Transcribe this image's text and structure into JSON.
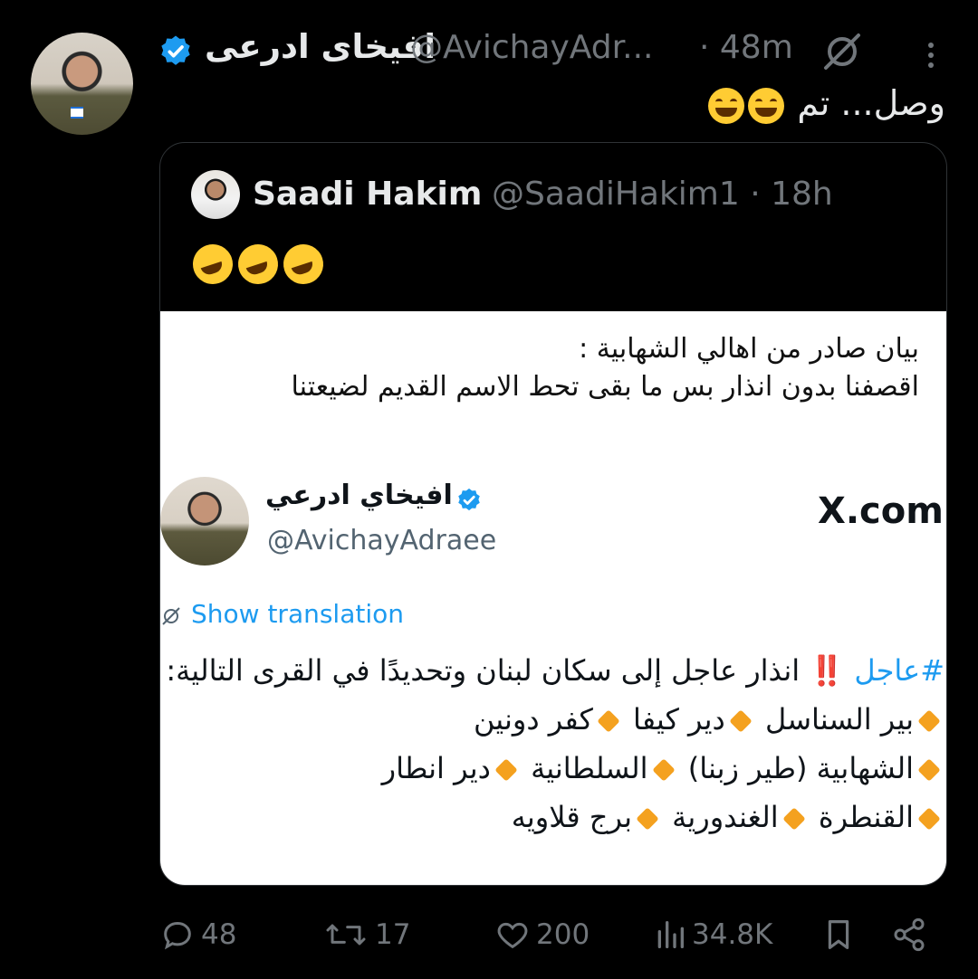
{
  "tweet": {
    "author_name": "افيخاى ادرعى",
    "author_handle": "@AvichayAdr...",
    "time": "· 48m",
    "text": "وصل... تم"
  },
  "quote": {
    "author_name": "Saadi Hakim",
    "author_handle": "@SaadiHakim1 · 18h"
  },
  "embed": {
    "line1": "بيان صادر من اهالي الشهابية :",
    "line2": "اقصفنا بدون انذار بس ما بقى تحط الاسم القديم لضيعتنا",
    "name": "افيخاي ادرعي",
    "handle": "@AvichayAdraee",
    "site": "X.com",
    "translate": "Show translation",
    "hashtag": "#عاجل",
    "bang": "‼️",
    "body_a": "انذار عاجل إلى سكان لبنان وتحديدًا في القرى التالية:",
    "village1": "بير السناسل",
    "village2": "دير كيفا",
    "village3": "كفر دونين",
    "village4": "الشهابية (طير زبنا)",
    "village5": "السلطانية",
    "village6": "دير انطار",
    "village7": "القنطرة",
    "village8": "الغندورية",
    "village9": "برج قلاويه"
  },
  "actions": {
    "replies": "48",
    "reposts": "17",
    "likes": "200",
    "views": "34.8K"
  },
  "colors": {
    "accent": "#1d9bf0",
    "muted": "#71767b",
    "diamond": "#f4a11f"
  }
}
